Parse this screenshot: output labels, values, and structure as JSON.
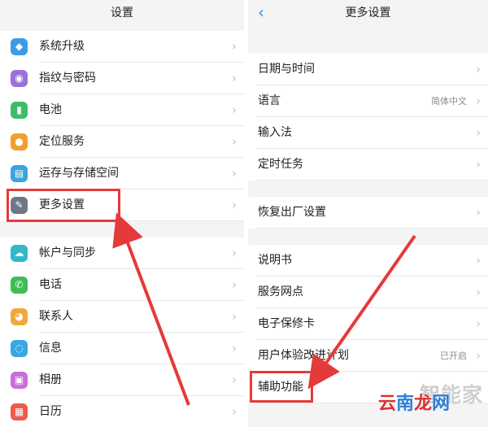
{
  "left": {
    "title": "设置",
    "items": [
      {
        "label": "系统升级",
        "icon": "system-update-icon",
        "color": "#3a9be8",
        "glyph": "◆"
      },
      {
        "label": "指纹与密码",
        "icon": "fingerprint-icon",
        "color": "#9b72d9",
        "glyph": "◉"
      },
      {
        "label": "电池",
        "icon": "battery-icon",
        "color": "#3dbd6a",
        "glyph": "▮"
      },
      {
        "label": "定位服务",
        "icon": "location-icon",
        "color": "#f0a031",
        "glyph": "●"
      },
      {
        "label": "运存与存储空间",
        "icon": "storage-icon",
        "color": "#3aa3e0",
        "glyph": "▤"
      },
      {
        "label": "更多设置",
        "icon": "wrench-icon",
        "color": "#6d7886",
        "glyph": "✎"
      },
      {
        "label": "帐户与同步",
        "icon": "cloud-sync-icon",
        "color": "#33b8c9",
        "glyph": "☁"
      },
      {
        "label": "电话",
        "icon": "phone-icon",
        "color": "#3fbd55",
        "glyph": "✆"
      },
      {
        "label": "联系人",
        "icon": "contacts-icon",
        "color": "#f2a93b",
        "glyph": "◕"
      },
      {
        "label": "信息",
        "icon": "message-icon",
        "color": "#39a7e6",
        "glyph": "◌"
      },
      {
        "label": "相册",
        "icon": "gallery-icon",
        "color": "#c86fd6",
        "glyph": "▣"
      },
      {
        "label": "日历",
        "icon": "calendar-icon",
        "color": "#ef5a4d",
        "glyph": "▦"
      }
    ]
  },
  "right": {
    "title": "更多设置",
    "back_glyph": "‹",
    "items": [
      {
        "label": "日期与时间",
        "value": ""
      },
      {
        "label": "语言",
        "value": "简体中文"
      },
      {
        "label": "输入法",
        "value": ""
      },
      {
        "label": "定时任务",
        "value": ""
      },
      {
        "label": "恢复出厂设置",
        "value": ""
      },
      {
        "label": "说明书",
        "value": ""
      },
      {
        "label": "服务网点",
        "value": ""
      },
      {
        "label": "电子保修卡",
        "value": ""
      },
      {
        "label": "用户体验改进计划",
        "value": "已开启"
      },
      {
        "label": "辅助功能",
        "value": ""
      }
    ]
  },
  "chevron": "›",
  "overlay": {
    "watermark": "智能家",
    "brand": [
      "云",
      "南",
      "龙",
      "网"
    ],
    "brand_colors": [
      "#e03030",
      "#2a7fd8",
      "#e03030",
      "#2a7fd8"
    ],
    "highlight_color": "#e53a3a"
  }
}
